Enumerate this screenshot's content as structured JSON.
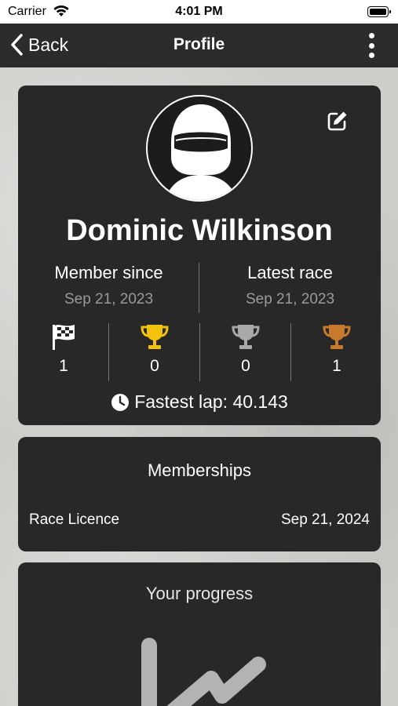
{
  "status_bar": {
    "carrier": "Carrier",
    "time": "4:01 PM"
  },
  "nav": {
    "back_label": "Back",
    "title": "Profile"
  },
  "profile": {
    "name": "Dominic Wilkinson",
    "member_since_label": "Member since",
    "member_since_value": "Sep 21, 2023",
    "latest_race_label": "Latest race",
    "latest_race_value": "Sep 21, 2023",
    "stats": [
      {
        "icon": "checkered-flag-icon",
        "count": "1"
      },
      {
        "icon": "gold-trophy-icon",
        "count": "0",
        "color": "#f2c20d"
      },
      {
        "icon": "silver-trophy-icon",
        "count": "0",
        "color": "#a9a9a9"
      },
      {
        "icon": "bronze-trophy-icon",
        "count": "1",
        "color": "#c87a2c"
      }
    ],
    "fastest_lap": "Fastest lap: 40.143"
  },
  "memberships": {
    "title": "Memberships",
    "items": [
      {
        "name": "Race Licence",
        "date": "Sep 21, 2024"
      }
    ]
  },
  "progress": {
    "title": "Your progress"
  },
  "colors": {
    "card_bg": "#282828",
    "nav_bg": "#2b2b2b",
    "muted_text": "#9a9a9a"
  }
}
